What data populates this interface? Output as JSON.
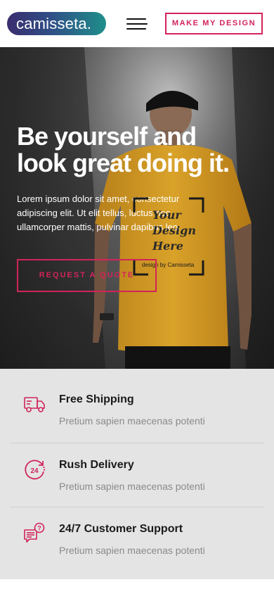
{
  "header": {
    "logo_text": "camisseta.",
    "cta_label": "MAKE MY DESIGN"
  },
  "hero": {
    "title": "Be yourself and look great doing it.",
    "body": "Lorem ipsum dolor sit amet, consectetur adipiscing elit. Ut elit tellus, luctus nec ullamcorper mattis, pulvinar dapibus leo.",
    "button_label": "REQUEST A QUOTE",
    "shirt_print_text": "Your Design Here",
    "shirt_print_caption": "design by Camisseta"
  },
  "features": [
    {
      "icon": "truck-icon",
      "title": "Free Shipping",
      "subtitle": "Pretium sapien maecenas potenti"
    },
    {
      "icon": "clock-24-icon",
      "title": "Rush Delivery",
      "subtitle": "Pretium sapien maecenas potenti"
    },
    {
      "icon": "support-chat-icon",
      "title": "24/7 Customer Support",
      "subtitle": "Pretium sapien maecenas potenti"
    }
  ],
  "colors": {
    "accent": "#d1245a",
    "feature_bg": "#e4e4e4",
    "shirt": "#d49a22"
  }
}
